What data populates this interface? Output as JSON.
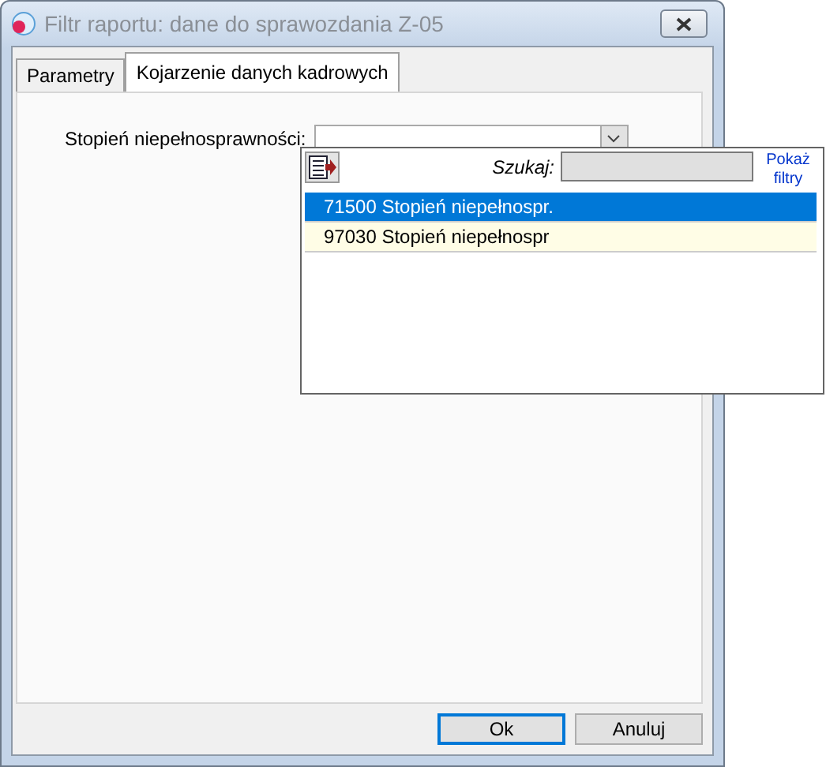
{
  "window": {
    "title": "Filtr raportu: dane do sprawozdania Z-05"
  },
  "tabs": [
    {
      "label": "Parametry",
      "selected": false
    },
    {
      "label": "Kojarzenie danych kadrowych",
      "selected": true
    }
  ],
  "field": {
    "label": "Stopień niepełnosprawności:"
  },
  "popup": {
    "search_label": "Szukaj:",
    "filters_link": "Pokaż filtry",
    "items": [
      {
        "text": "71500 Stopień niepełnospr.",
        "selected": true
      },
      {
        "text": "97030 Stopień niepełnospr",
        "selected": false
      }
    ]
  },
  "buttons": [
    {
      "label": "Ok",
      "default": true
    },
    {
      "label": "Anuluj",
      "default": false
    }
  ]
}
